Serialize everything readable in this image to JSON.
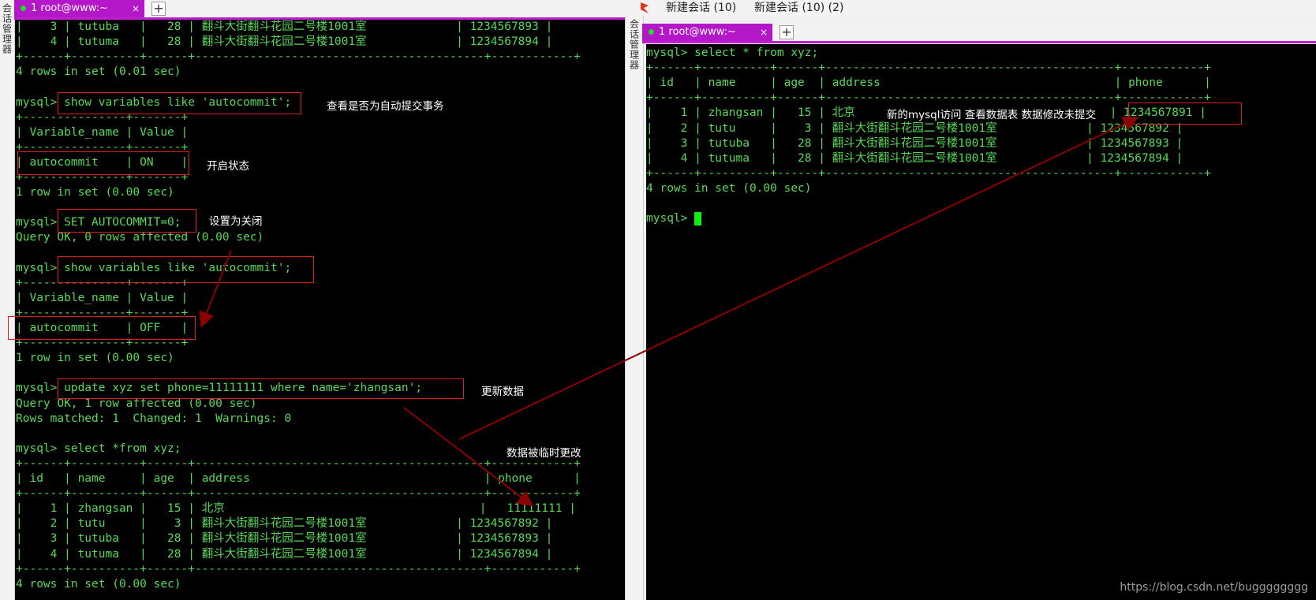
{
  "left": {
    "side_label": "会话管理器",
    "tab_label": "1 root@www:~",
    "close_glyph": "×",
    "plus_glyph": "+",
    "lines": [
      "|    3 | tutuba   |   28 | 翻斗大街翻斗花园二号楼1001室             | 1234567893 |",
      "|    4 | tutuma   |   28 | 翻斗大街翻斗花园二号楼1001室             | 1234567894 |",
      "+------+----------+------+------------------------------------------+------------+",
      "4 rows in set (0.01 sec)",
      "",
      "mysql> show variables like 'autocommit';",
      "+---------------+-------+",
      "| Variable_name | Value |",
      "+---------------+-------+",
      "| autocommit    | ON    |",
      "+---------------+-------+",
      "1 row in set (0.00 sec)",
      "",
      "mysql> SET AUTOCOMMIT=0;",
      "Query OK, 0 rows affected (0.00 sec)",
      "",
      "mysql> show variables like 'autocommit';",
      "+---------------+-------+",
      "| Variable_name | Value |",
      "+---------------+-------+",
      "| autocommit    | OFF   |",
      "+---------------+-------+",
      "1 row in set (0.00 sec)",
      "",
      "mysql> update xyz set phone=11111111 where name='zhangsan';",
      "Query OK, 1 row affected (0.00 sec)",
      "Rows matched: 1  Changed: 1  Warnings: 0",
      "",
      "mysql> select *from xyz;",
      "+------+----------+------+------------------------------------------+------------+",
      "| id   | name     | age  | address                                  | phone      |",
      "+------+----------+------+------------------------------------------+------------+",
      "|    1 | zhangsan |   15 | 北京                                     |   11111111 |",
      "|    2 | tutu     |    3 | 翻斗大街翻斗花园二号楼1001室             | 1234567892 |",
      "|    3 | tutuba   |   28 | 翻斗大街翻斗花园二号楼1001室             | 1234567893 |",
      "|    4 | tutuma   |   28 | 翻斗大街翻斗花园二号楼1001室             | 1234567894 |",
      "+------+----------+------+------------------------------------------+------------+",
      "4 rows in set (0.00 sec)"
    ],
    "annotations": {
      "check_autocommit": "查看是否为自动提交事务",
      "on_state": "开启状态",
      "set_off": "设置为关闭",
      "update_data": "更新数据",
      "temp_changed": "数据被临时更改"
    }
  },
  "right": {
    "top_items": [
      "新建会话 (10)",
      "新建会话 (10) (2)"
    ],
    "side_label": "会话管理器",
    "tab_label": "1 root@www:~",
    "close_glyph": "×",
    "plus_glyph": "+",
    "lines": [
      "mysql> select * from xyz;",
      "+------+----------+------+------------------------------------------+------------+",
      "| id   | name     | age  | address                                  | phone      |",
      "+------+----------+------+------------------------------------------+------------+",
      "|    1 | zhangsan |   15 | 北京                                     | 1234567891 |",
      "|    2 | tutu     |    3 | 翻斗大街翻斗花园二号楼1001室             | 1234567892 |",
      "|    3 | tutuba   |   28 | 翻斗大街翻斗花园二号楼1001室             | 1234567893 |",
      "|    4 | tutuma   |   28 | 翻斗大街翻斗花园二号楼1001室             | 1234567894 |",
      "+------+----------+------+------------------------------------------+------------+",
      "4 rows in set (0.00 sec)",
      ""
    ],
    "prompt": "mysql> ",
    "annotation": "新的mysql访问  查看数据表  数据修改未提交"
  },
  "watermark": "https://blog.csdn.net/bugggggggg",
  "colors": {
    "terminal_bg": "#000000",
    "terminal_text": "#57d957",
    "tab_active": "#b317c8",
    "annotation_box": "#e02020",
    "arrow": "#8b0000"
  }
}
